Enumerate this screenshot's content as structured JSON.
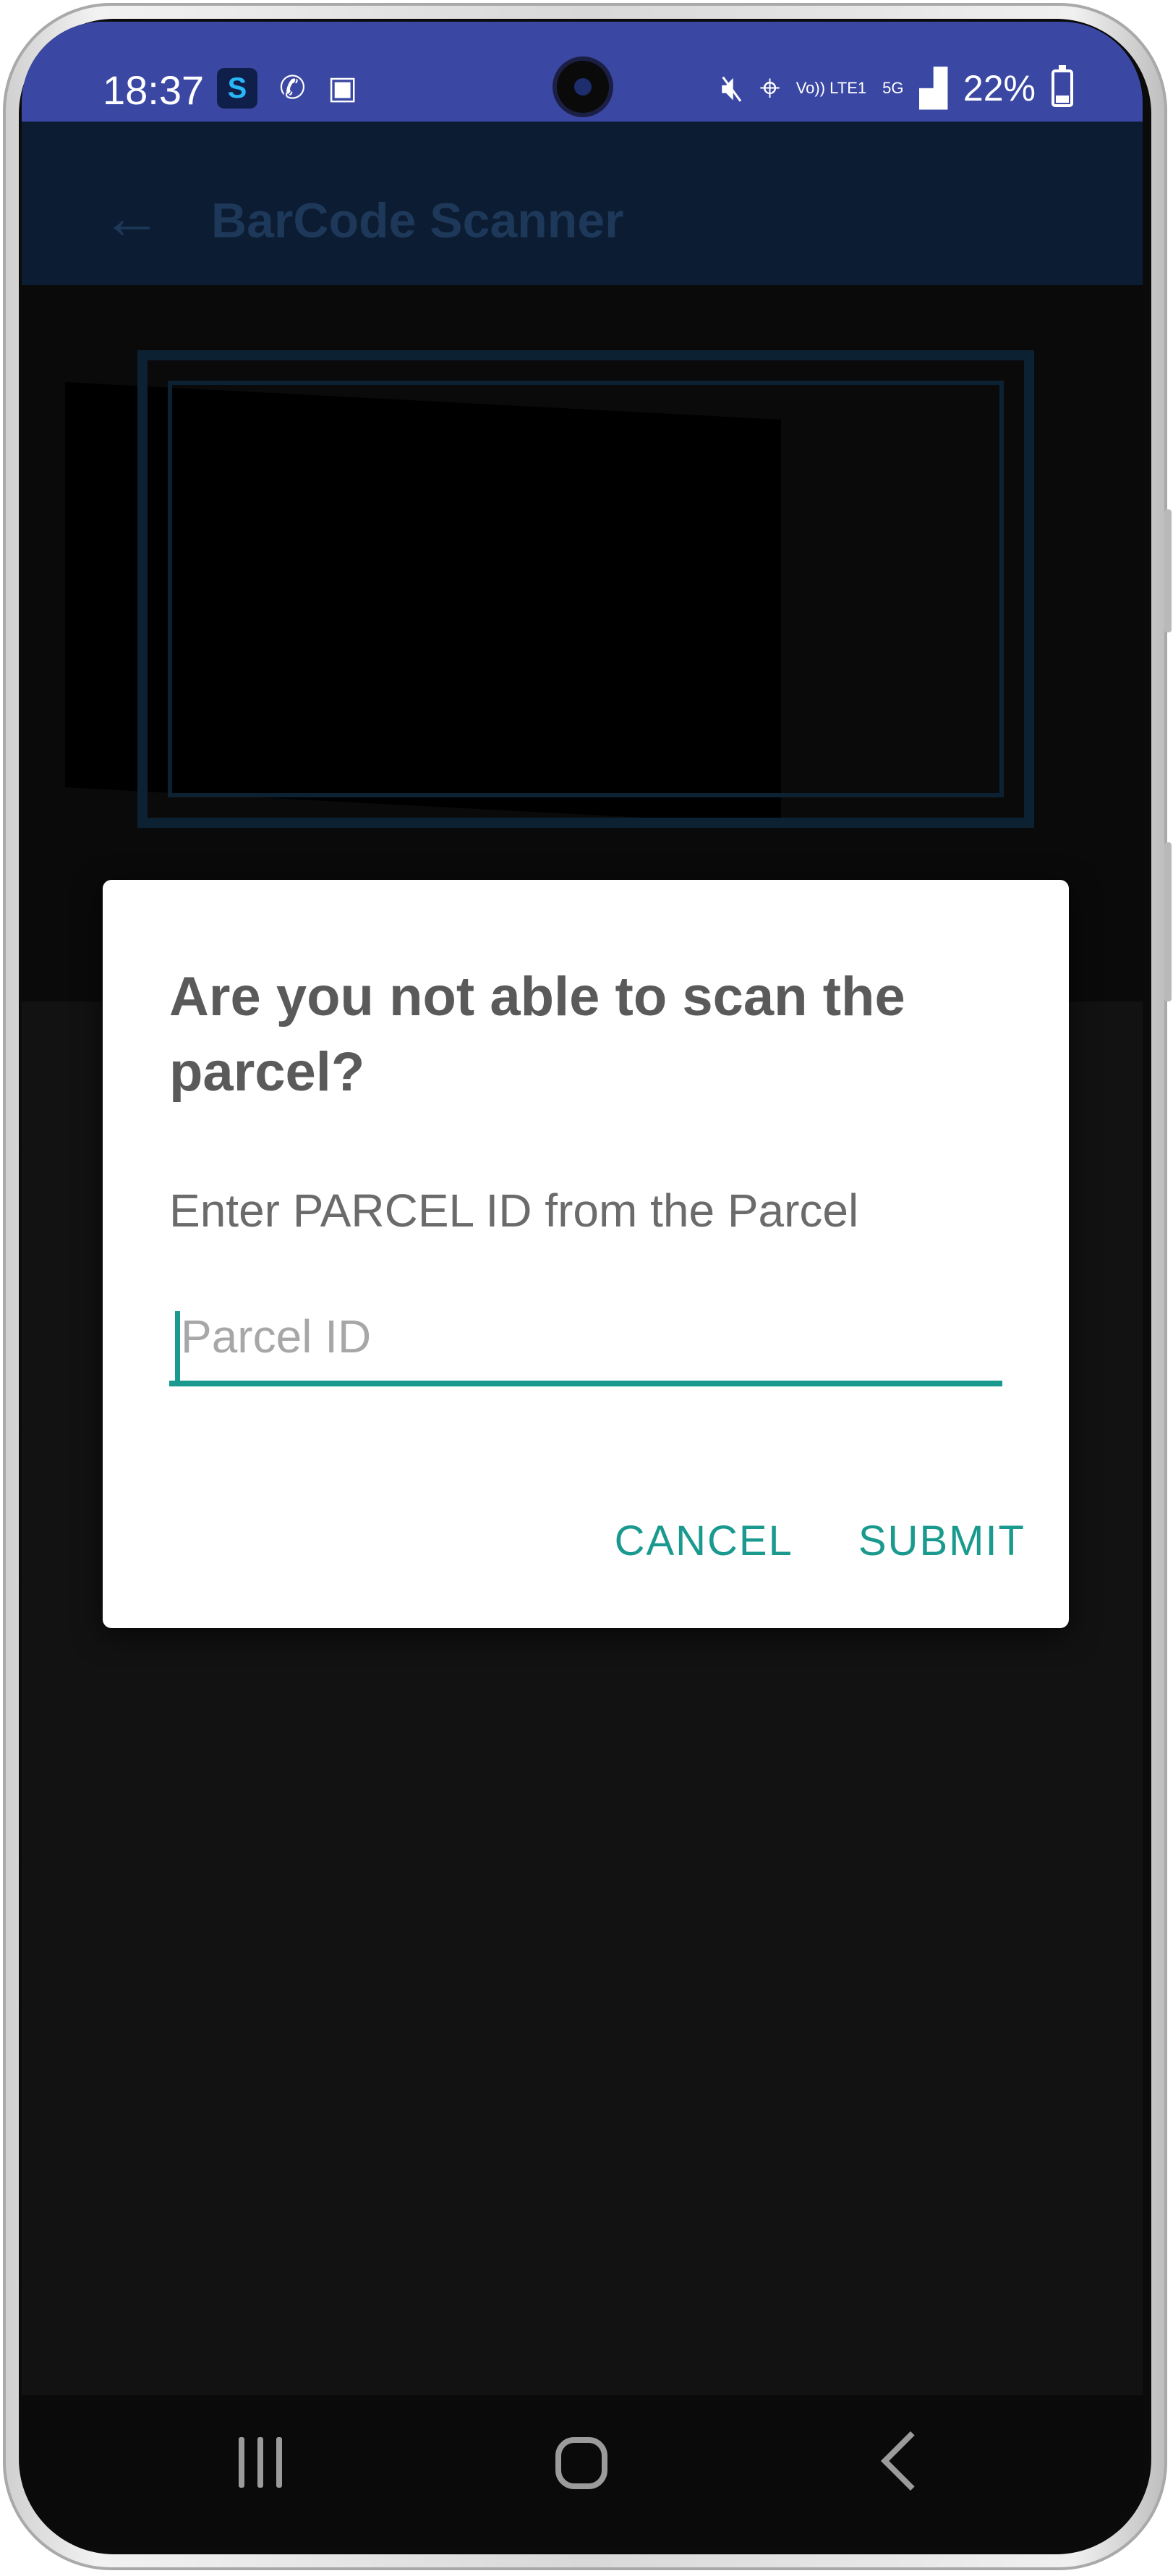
{
  "status_bar": {
    "time": "18:37",
    "app_badge": "S",
    "network_small": "Vo)) LTE1",
    "network_5g": "5G",
    "battery": "22%"
  },
  "app_bar": {
    "back_icon": "arrow-left-icon",
    "title": "BarCode Scanner"
  },
  "dialog": {
    "title": "Are you not able to scan the parcel?",
    "message": "Enter PARCEL ID from the Parcel",
    "input": {
      "placeholder": "Parcel ID",
      "value": ""
    },
    "cancel_label": "CANCEL",
    "submit_label": "SUBMIT"
  },
  "colors": {
    "status_bar": "#3b48a3",
    "accent": "#1a9a8e",
    "scrim": "#121212"
  }
}
